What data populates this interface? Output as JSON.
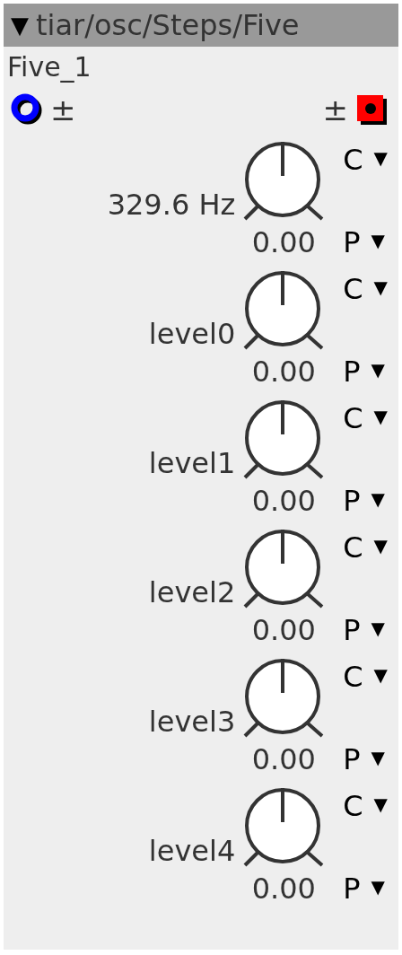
{
  "header": {
    "toggle": "▼",
    "title": "tiar/osc/Steps/Five",
    "expanded": true
  },
  "instance_name": "Five_1",
  "inlet": {
    "sign": "±"
  },
  "outlet": {
    "sign": "±"
  },
  "params": [
    {
      "label": "329.6 Hz",
      "value": "0.00",
      "top_menu": {
        "label": "C",
        "arrow": "▼"
      },
      "bottom_menu": {
        "label": "P",
        "arrow": "▼"
      }
    },
    {
      "label": "level0",
      "value": "0.00",
      "top_menu": {
        "label": "C",
        "arrow": "▼"
      },
      "bottom_menu": {
        "label": "P",
        "arrow": "▼"
      }
    },
    {
      "label": "level1",
      "value": "0.00",
      "top_menu": {
        "label": "C",
        "arrow": "▼"
      },
      "bottom_menu": {
        "label": "P",
        "arrow": "▼"
      }
    },
    {
      "label": "level2",
      "value": "0.00",
      "top_menu": {
        "label": "C",
        "arrow": "▼"
      },
      "bottom_menu": {
        "label": "P",
        "arrow": "▼"
      }
    },
    {
      "label": "level3",
      "value": "0.00",
      "top_menu": {
        "label": "C",
        "arrow": "▼"
      },
      "bottom_menu": {
        "label": "P",
        "arrow": "▼"
      }
    },
    {
      "label": "level4",
      "value": "0.00",
      "top_menu": {
        "label": "C",
        "arrow": "▼"
      },
      "bottom_menu": {
        "label": "P",
        "arrow": "▼"
      }
    }
  ]
}
